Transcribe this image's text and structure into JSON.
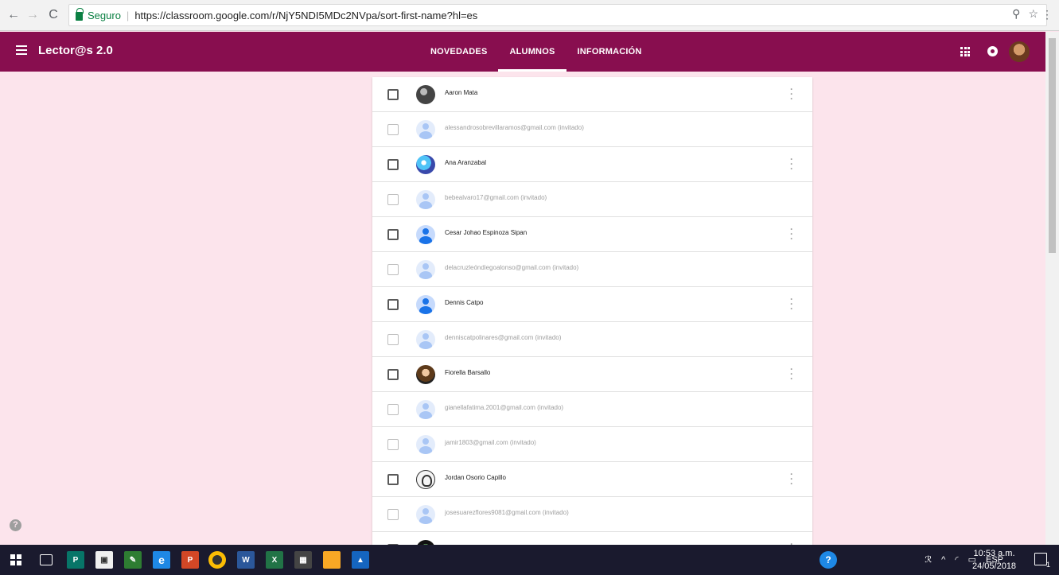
{
  "browser": {
    "secure_label": "Seguro",
    "url": "https://classroom.google.com/r/NjY5NDI5MDc2NVpa/sort-first-name?hl=es",
    "icons": [
      "back-arrow",
      "forward-arrow",
      "reload",
      "zoom",
      "star",
      "menu-dots"
    ]
  },
  "header": {
    "title": "Lector@s 2.0",
    "color": "#880e4f",
    "tabs": [
      {
        "label": "NOVEDADES",
        "active": false
      },
      {
        "label": "ALUMNOS",
        "active": true
      },
      {
        "label": "INFORMACIÓN",
        "active": false
      }
    ]
  },
  "roster": {
    "students": [
      {
        "name": "Aaron Mata",
        "invited": false
      },
      {
        "name": "alessandrosobrevillaramos@gmail.com  (invitado)",
        "invited": true
      },
      {
        "name": "Ana Aranzabal",
        "invited": false
      },
      {
        "name": "bebealvaro17@gmail.com  (invitado)",
        "invited": true
      },
      {
        "name": "Cesar Johao Espinoza Sipan",
        "invited": false
      },
      {
        "name": "delacruzleóndiegoalonso@gmail.com  (invitado)",
        "invited": true
      },
      {
        "name": "Dennis Catpo",
        "invited": false
      },
      {
        "name": "denniscatpolinares@gmail.com  (invitado)",
        "invited": true
      },
      {
        "name": "Fiorella Barsallo",
        "invited": false
      },
      {
        "name": "gianellafatima.2001@gmail.com  (invitado)",
        "invited": true
      },
      {
        "name": "jamir1803@gmail.com  (invitado)",
        "invited": true
      },
      {
        "name": "Jordan Osorio Capillo",
        "invited": false
      },
      {
        "name": "josesuarezflores9081@gmail.com  (invitado)",
        "invited": true
      }
    ]
  },
  "taskbar": {
    "language": "ESP",
    "time": "10:53 a.m.",
    "date": "24/05/2018",
    "notification_count": "1"
  },
  "help_icon": "?"
}
